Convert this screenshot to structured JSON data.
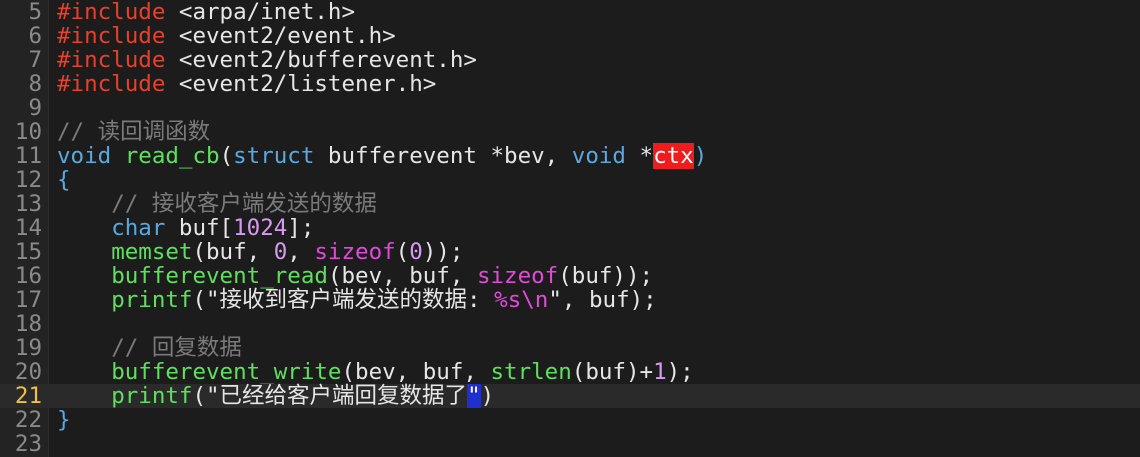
{
  "editor": {
    "lines": [
      {
        "num": "5",
        "tokens": [
          {
            "t": "#include",
            "c": "pp"
          },
          {
            "t": " <arpa/inet.h>",
            "c": "inc"
          }
        ]
      },
      {
        "num": "6",
        "tokens": [
          {
            "t": "#include",
            "c": "pp"
          },
          {
            "t": " <event2/event.h>",
            "c": "inc"
          }
        ]
      },
      {
        "num": "7",
        "tokens": [
          {
            "t": "#include",
            "c": "pp"
          },
          {
            "t": " <event2/bufferevent.h>",
            "c": "inc"
          }
        ]
      },
      {
        "num": "8",
        "tokens": [
          {
            "t": "#include",
            "c": "pp"
          },
          {
            "t": " <event2/listener.h>",
            "c": "inc"
          }
        ]
      },
      {
        "num": "9",
        "tokens": []
      },
      {
        "num": "10",
        "tokens": [
          {
            "t": "// 读回调函数",
            "c": "cm"
          }
        ]
      },
      {
        "num": "11",
        "tokens": [
          {
            "t": "void",
            "c": "kw"
          },
          {
            "t": " ",
            "c": "id"
          },
          {
            "t": "read_cb",
            "c": "fn"
          },
          {
            "t": "(",
            "c": "pn"
          },
          {
            "t": "struct",
            "c": "kw"
          },
          {
            "t": " bufferevent *bev, ",
            "c": "id"
          },
          {
            "t": "void",
            "c": "kw"
          },
          {
            "t": " *",
            "c": "id"
          },
          {
            "t": "ctx",
            "c": "hl-red"
          },
          {
            "t": ")",
            "c": "kw"
          }
        ]
      },
      {
        "num": "12",
        "tokens": [
          {
            "t": "{",
            "c": "kw"
          }
        ]
      },
      {
        "num": "13",
        "tokens": [
          {
            "t": "    ",
            "c": "id"
          },
          {
            "t": "// 接收客户端发送的数据",
            "c": "cm"
          }
        ]
      },
      {
        "num": "14",
        "tokens": [
          {
            "t": "    ",
            "c": "id"
          },
          {
            "t": "char",
            "c": "kw"
          },
          {
            "t": " buf[",
            "c": "id"
          },
          {
            "t": "1024",
            "c": "num"
          },
          {
            "t": "];",
            "c": "id"
          }
        ]
      },
      {
        "num": "15",
        "tokens": [
          {
            "t": "    ",
            "c": "id"
          },
          {
            "t": "memset",
            "c": "fn"
          },
          {
            "t": "(buf, ",
            "c": "id"
          },
          {
            "t": "0",
            "c": "num"
          },
          {
            "t": ", ",
            "c": "id"
          },
          {
            "t": "sizeof",
            "c": "kw2"
          },
          {
            "t": "(",
            "c": "id"
          },
          {
            "t": "0",
            "c": "num"
          },
          {
            "t": "));",
            "c": "id"
          }
        ]
      },
      {
        "num": "16",
        "tokens": [
          {
            "t": "    ",
            "c": "id"
          },
          {
            "t": "bufferevent_read",
            "c": "fn"
          },
          {
            "t": "(bev, buf, ",
            "c": "id"
          },
          {
            "t": "sizeof",
            "c": "kw2"
          },
          {
            "t": "(buf));",
            "c": "id"
          }
        ]
      },
      {
        "num": "17",
        "tokens": [
          {
            "t": "    ",
            "c": "id"
          },
          {
            "t": "printf",
            "c": "fn"
          },
          {
            "t": "(\"接收到客户端发送的数据: ",
            "c": "str"
          },
          {
            "t": "%s\\n",
            "c": "esc"
          },
          {
            "t": "\", buf);",
            "c": "str"
          }
        ]
      },
      {
        "num": "18",
        "tokens": []
      },
      {
        "num": "19",
        "tokens": [
          {
            "t": "    ",
            "c": "id"
          },
          {
            "t": "// 回复数据",
            "c": "cm"
          }
        ]
      },
      {
        "num": "20",
        "tokens": [
          {
            "t": "    ",
            "c": "id"
          },
          {
            "t": "bufferevent_write",
            "c": "fn"
          },
          {
            "t": "(bev, buf, ",
            "c": "id"
          },
          {
            "t": "strlen",
            "c": "fn"
          },
          {
            "t": "(buf)+",
            "c": "id"
          },
          {
            "t": "1",
            "c": "num"
          },
          {
            "t": ");",
            "c": "id"
          }
        ]
      },
      {
        "num": "21",
        "current": true,
        "tokens": [
          {
            "t": "    ",
            "c": "id"
          },
          {
            "t": "printf",
            "c": "fn"
          },
          {
            "t": "(\"已经给客户端回复数据了",
            "c": "str"
          },
          {
            "t": "\"",
            "c": "caret-sel"
          },
          {
            "t": ")",
            "c": "str"
          }
        ]
      },
      {
        "num": "22",
        "tokens": [
          {
            "t": "}",
            "c": "kw"
          }
        ]
      },
      {
        "num": "23",
        "tokens": []
      }
    ]
  }
}
